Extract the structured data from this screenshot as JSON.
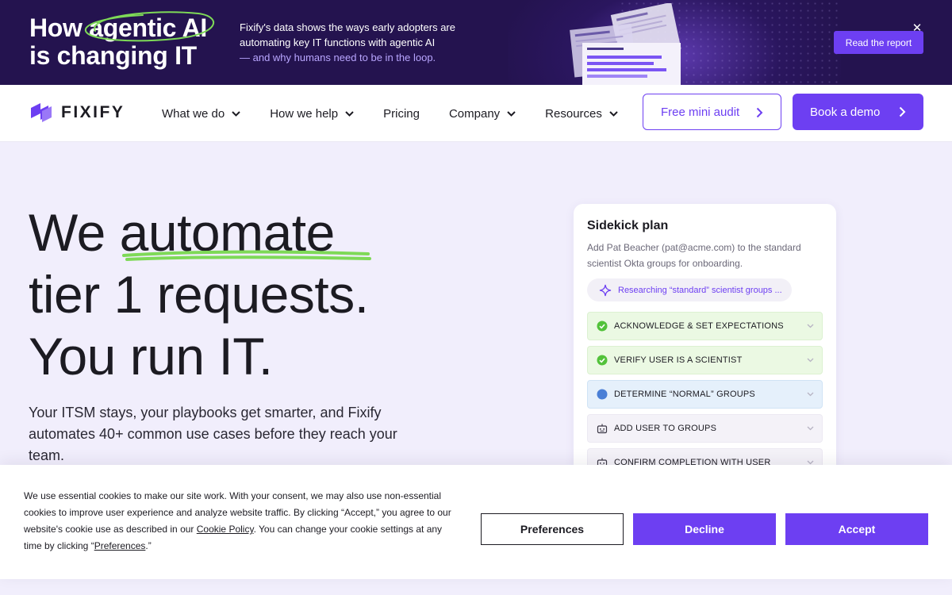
{
  "banner": {
    "headline_part1": "How ",
    "headline_highlight": "agentic AI",
    "headline_line2": "is changing IT",
    "copy_main": "Fixify's data shows the ways early adopters are automating key IT functions with agentic AI",
    "copy_accent": "— and why humans need to be in the loop.",
    "cta_label": "Read the report",
    "close_glyph": "✕"
  },
  "nav": {
    "logo_text": "FIXIFY",
    "items": [
      {
        "label": "What we do",
        "has_dropdown": true
      },
      {
        "label": "How we help",
        "has_dropdown": true
      },
      {
        "label": "Pricing",
        "has_dropdown": false
      },
      {
        "label": "Company",
        "has_dropdown": true
      },
      {
        "label": "Resources",
        "has_dropdown": true
      }
    ],
    "audit_label": "Free mini audit",
    "demo_label": "Book a demo"
  },
  "hero": {
    "line1_pre": "We ",
    "line1_highlight": "automate",
    "line2": "tier 1 requests.",
    "line3": "You run IT.",
    "subtitle": "Your ITSM stays, your playbooks get smarter, and Fixify automates 40+ common use cases before they reach your team."
  },
  "sidekick": {
    "title": "Sidekick plan",
    "description": "Add Pat Beacher (pat@acme.com) to the standard scientist Okta groups for onboarding.",
    "status_chip": "Researching “standard” scientist groups ...",
    "steps": [
      {
        "label": "ACKNOWLEDGE & SET EXPECTATIONS",
        "state": "done"
      },
      {
        "label": "VERIFY USER IS A SCIENTIST",
        "state": "done"
      },
      {
        "label": "DETERMINE “NORMAL” GROUPS",
        "state": "active"
      },
      {
        "label": "ADD USER TO GROUPS",
        "state": "todo"
      },
      {
        "label": "CONFIRM COMPLETION WITH USER",
        "state": "todo"
      }
    ]
  },
  "cookie": {
    "text_part1": "We use essential cookies to make our site work. With your consent, we may also use non-essential cookies to improve user experience and analyze website traffic. By clicking “Accept,” you agree to our website's cookie use as described in our ",
    "policy_link": "Cookie Policy",
    "text_part2": ". You can change your cookie settings at any time by clicking “",
    "preferences_link": "Preferences",
    "text_part3": ".”",
    "preferences_label": "Preferences",
    "decline_label": "Decline",
    "accept_label": "Accept"
  },
  "colors": {
    "brand_purple": "#6d3ff2",
    "banner_bg": "#24134f",
    "highlight_green": "#7ed957",
    "hero_bg": "#f1eefc"
  }
}
